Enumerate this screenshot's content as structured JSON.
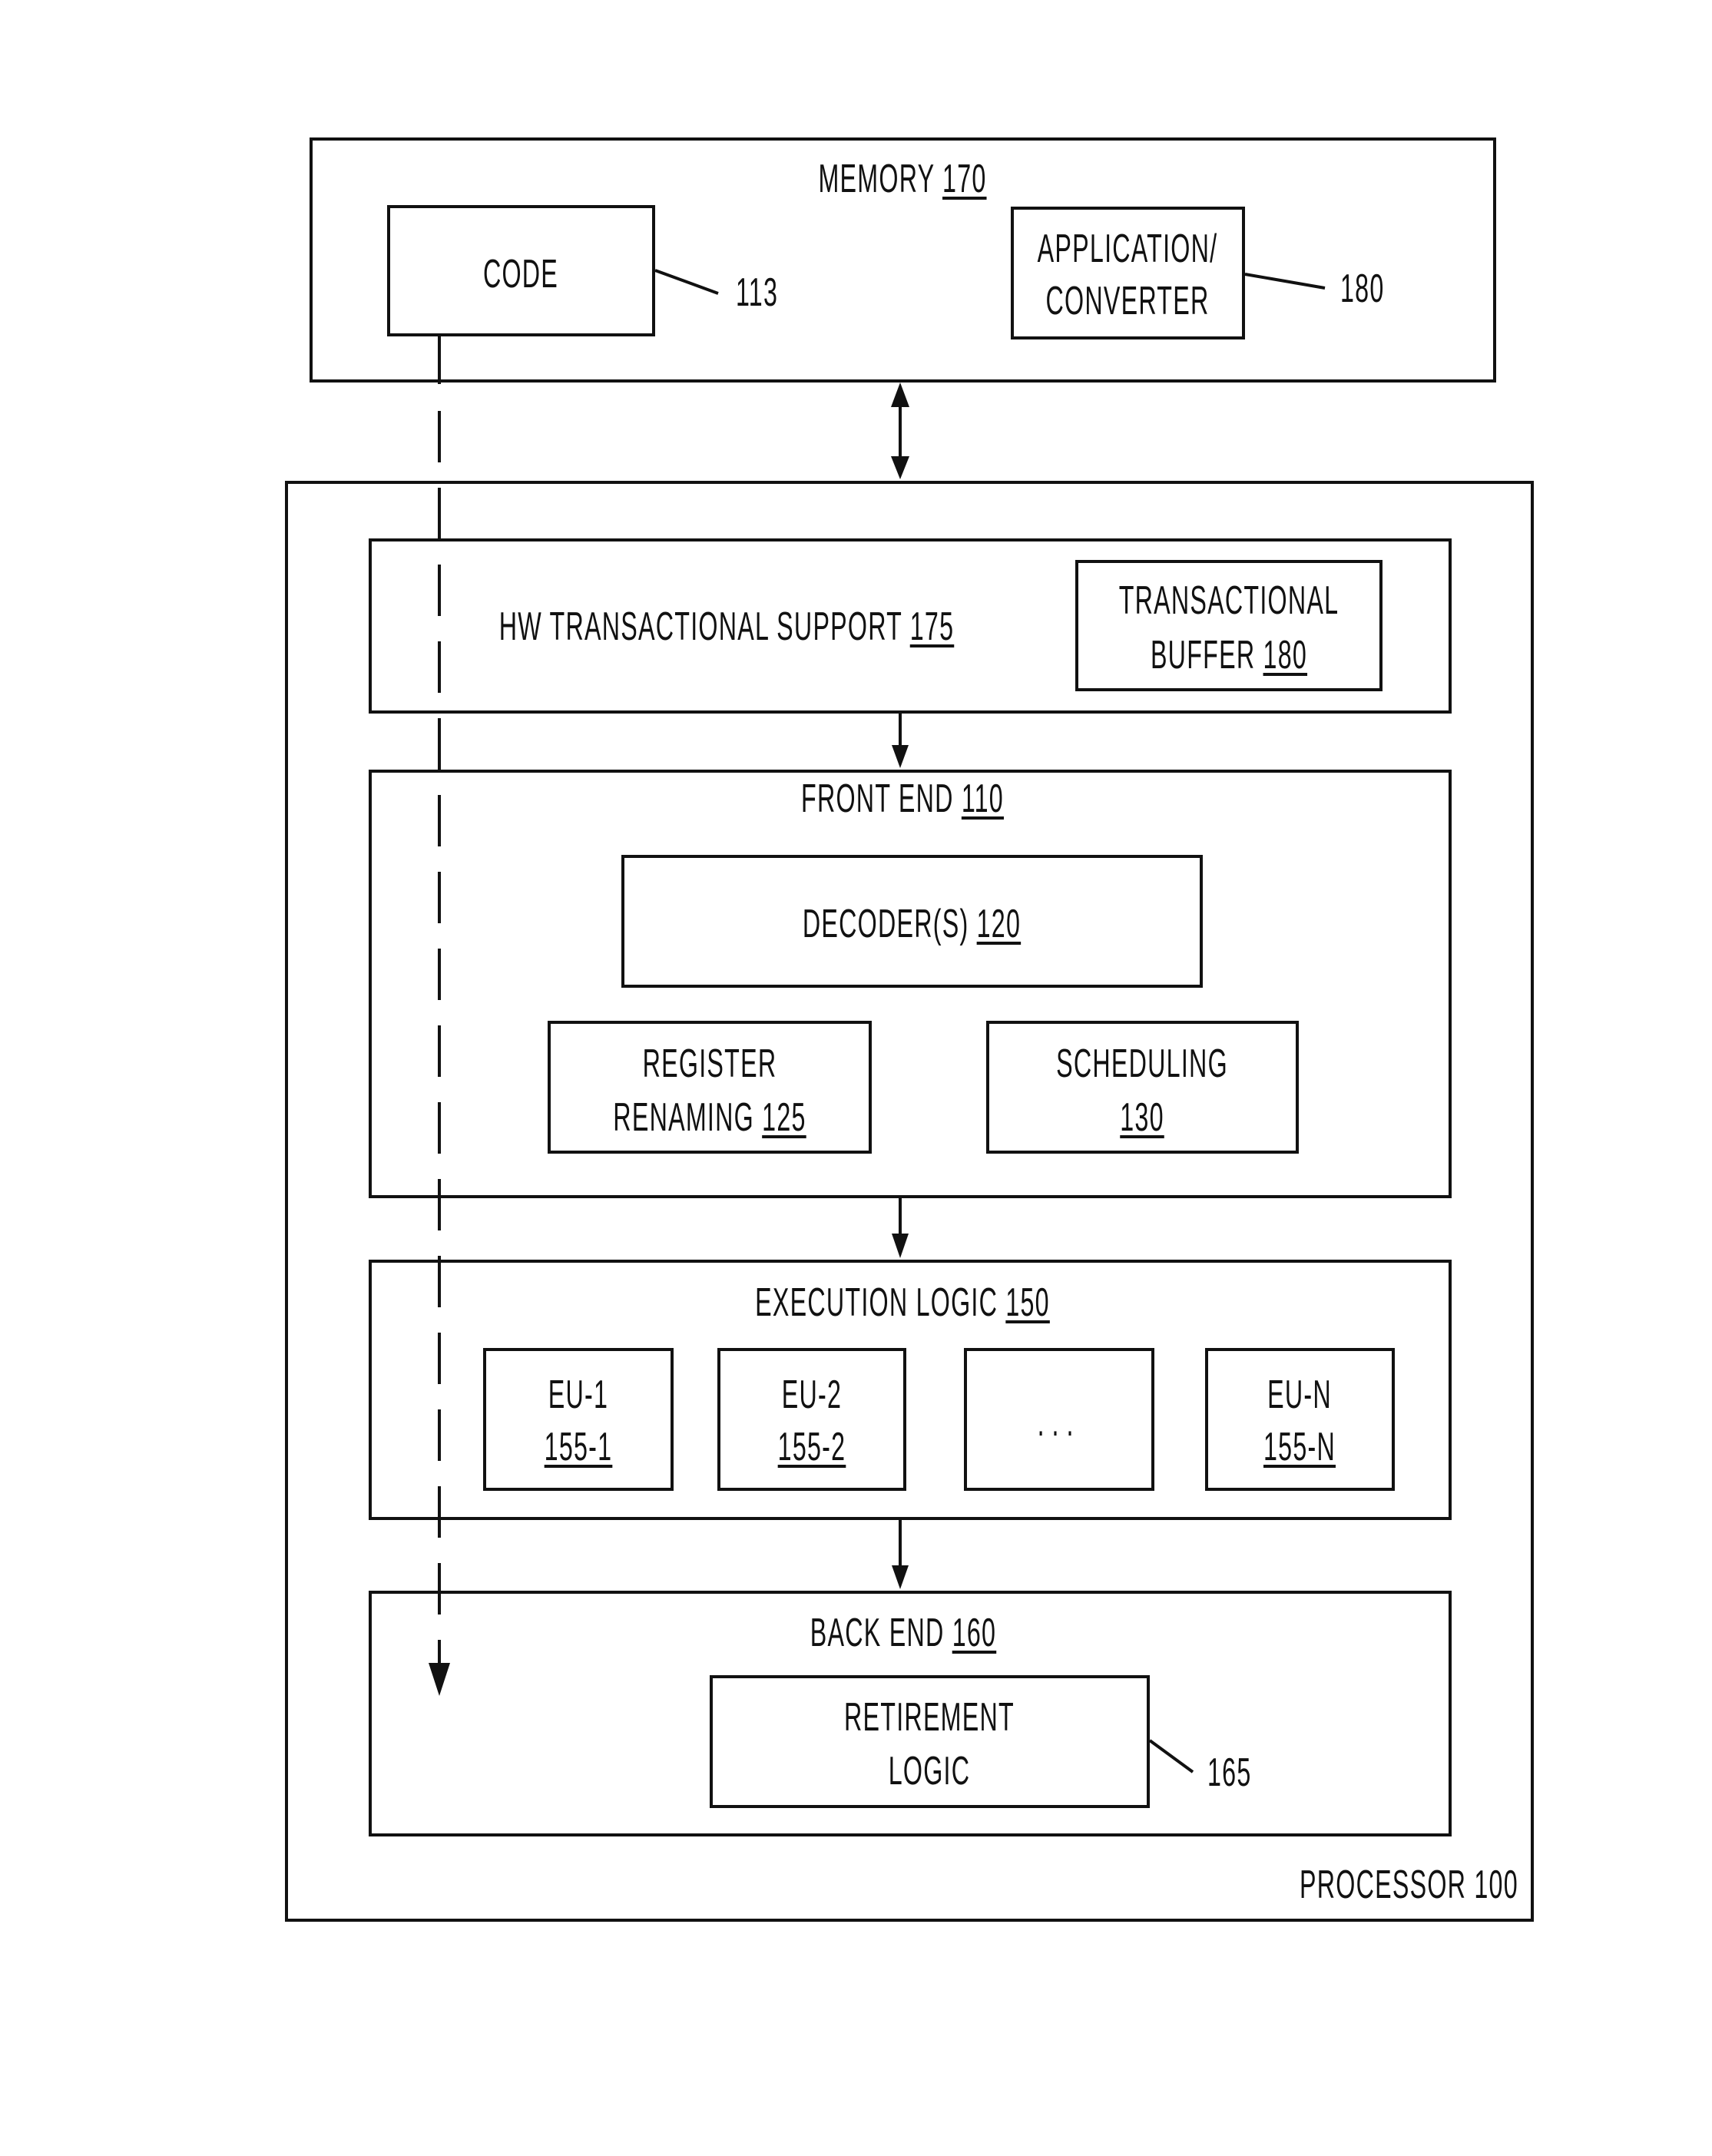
{
  "memory": {
    "title": "MEMORY",
    "ref": "170",
    "code": {
      "label": "CODE",
      "ref": "113"
    },
    "app": {
      "line1": "APPLICATION/",
      "line2": "CONVERTER",
      "ref": "180"
    }
  },
  "processor": {
    "title": "PROCESSOR",
    "ref": "100",
    "hw_support": {
      "label": "HW TRANSACTIONAL SUPPORT",
      "ref": "175",
      "buffer": {
        "line1": "TRANSACTIONAL",
        "line2": "BUFFER",
        "ref": "180"
      }
    },
    "front_end": {
      "title": "FRONT END",
      "ref": "110",
      "decoder": {
        "label": "DECODER(S)",
        "ref": "120"
      },
      "register": {
        "line1": "REGISTER",
        "line2": "RENAMING",
        "ref": "125"
      },
      "scheduling": {
        "line1": "SCHEDULING",
        "ref": "130"
      }
    },
    "execution": {
      "title": "EXECUTION LOGIC",
      "ref": "150",
      "units": [
        {
          "label": "EU-1",
          "ref": "155-1"
        },
        {
          "label": "EU-2",
          "ref": "155-2"
        },
        {
          "label": "...",
          "ref": ""
        },
        {
          "label": "EU-N",
          "ref": "155-N"
        }
      ]
    },
    "back_end": {
      "title": "BACK END",
      "ref": "160",
      "retirement": {
        "line1": "RETIREMENT",
        "line2": "LOGIC",
        "ref": "165"
      }
    }
  }
}
